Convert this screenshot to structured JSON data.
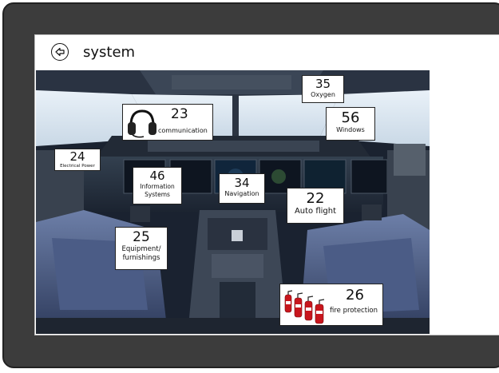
{
  "header": {
    "title": "system",
    "back_icon": "back-arrow-icon"
  },
  "systems": {
    "communication": {
      "number": "23",
      "label": "communication",
      "icon": "headset-icon"
    },
    "oxygen": {
      "number": "35",
      "label": "Oxygen"
    },
    "windows": {
      "number": "56",
      "label": "Windows"
    },
    "electrical_power": {
      "number": "24",
      "label": "Electrical Power"
    },
    "information_systems": {
      "number": "46",
      "label": "Information Systems"
    },
    "navigation": {
      "number": "34",
      "label": "Navigation"
    },
    "auto_flight": {
      "number": "22",
      "label": "Auto flight"
    },
    "equipment_furnishings": {
      "number": "25",
      "label": "Equipment/ furnishings"
    },
    "fire_protection": {
      "number": "26",
      "label": "fire protection",
      "icon": "fire-extinguisher-icon"
    }
  }
}
